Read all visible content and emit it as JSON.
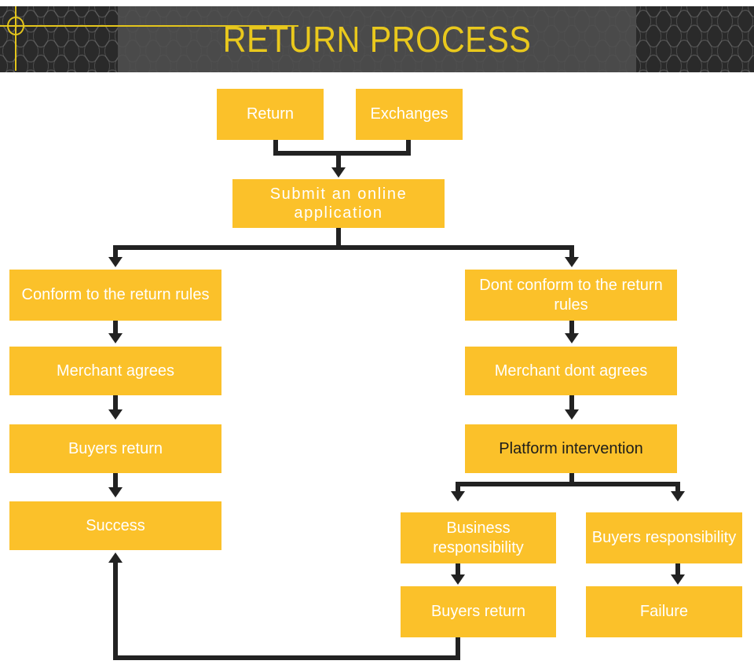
{
  "header": {
    "title": "RETURN PROCESS",
    "title_color": "#e9c81d",
    "band_color": "#2a2a2a",
    "panel_color": "#4e4e4e",
    "decor": {
      "circle": "circle-decoration",
      "hline": "horizontal-rule-decoration",
      "vline": "vertical-rule-decoration"
    }
  },
  "flowchart": {
    "box_color": "#fbc12a",
    "text_color": "#ffffff",
    "dark_text_color": "#1d1d1b",
    "connector_color": "#222222",
    "nodes": [
      {
        "id": "return",
        "label": "Return"
      },
      {
        "id": "exchanges",
        "label": "Exchanges"
      },
      {
        "id": "submit-application",
        "label": "Submit an online application"
      },
      {
        "id": "conform-rules",
        "label": "Conform to the return rules"
      },
      {
        "id": "merchant-agrees",
        "label": "Merchant agrees"
      },
      {
        "id": "buyers-return-left",
        "label": "Buyers return"
      },
      {
        "id": "success",
        "label": "Success"
      },
      {
        "id": "dont-conform-rules",
        "label": "Dont conform to the return rules"
      },
      {
        "id": "merchant-dont-agrees",
        "label": "Merchant dont agrees"
      },
      {
        "id": "platform-intervention",
        "label": "Platform intervention"
      },
      {
        "id": "business-responsibility",
        "label": "Business responsibility"
      },
      {
        "id": "buyers-responsibility",
        "label": "Buyers responsibility"
      },
      {
        "id": "buyers-return-bottom",
        "label": "Buyers return"
      },
      {
        "id": "failure",
        "label": "Failure"
      }
    ]
  }
}
